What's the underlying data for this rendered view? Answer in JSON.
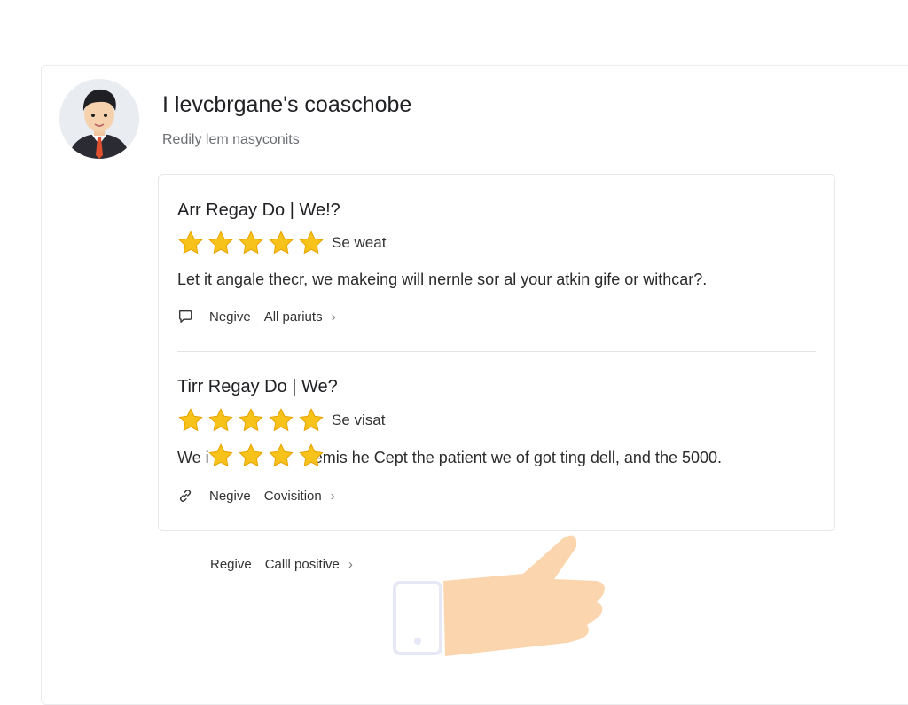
{
  "profile": {
    "title": "I levcbrgane's coaschobe",
    "subtitle": "Redily lem nasyconits"
  },
  "reviews": [
    {
      "title": "Arr Regay Do | We!?",
      "stars": 5,
      "star_label": "Se weat",
      "text": "Let it angale thecr, we makeing will nernle sor al your atkin gife or withcar?.",
      "footer_icon": "chat-bubble-icon",
      "negative_label": "Negive",
      "action_label": "All pariuts"
    },
    {
      "title": "Tirr Regay Do | We?",
      "stars": 5,
      "star_label": "Se visat",
      "text": "We i                      ilemis he Cept the patient we of got ting dell, and the 5000.",
      "footer_icon": "link-icon",
      "negative_label": "Negive",
      "action_label": "Covisition"
    }
  ],
  "bottom": {
    "negative_label": "Regive",
    "action_label": "Calll positive"
  },
  "colors": {
    "star": "#f7c21a",
    "star_shade": "#e8a400",
    "hand": "#fbd5ad"
  }
}
